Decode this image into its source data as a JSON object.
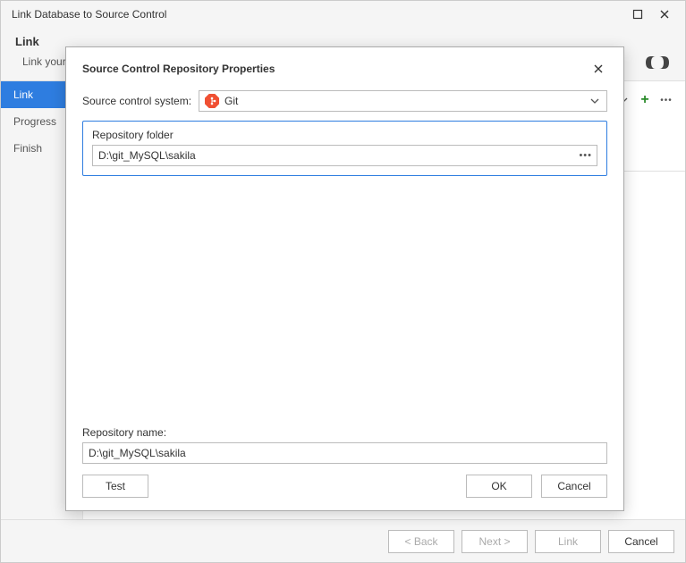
{
  "main": {
    "title": "Link Database to Source Control",
    "header_title": "Link",
    "header_subtitle": "Link your",
    "sidebar": {
      "items": [
        {
          "label": "Link",
          "active": true
        },
        {
          "label": "Progress",
          "active": false
        },
        {
          "label": "Finish",
          "active": false
        }
      ]
    },
    "footer": {
      "back": "< Back",
      "next": "Next >",
      "link": "Link",
      "cancel": "Cancel"
    }
  },
  "modal": {
    "title": "Source Control Repository Properties",
    "scs_label": "Source control system:",
    "scs_value": "Git",
    "fieldset_label": "Repository folder",
    "folder_value": "D:\\git_MySQL\\sakila",
    "repo_name_label": "Repository name:",
    "repo_name_value": "D:\\git_MySQL\\sakila",
    "test_btn": "Test",
    "ok_btn": "OK",
    "cancel_btn": "Cancel"
  }
}
